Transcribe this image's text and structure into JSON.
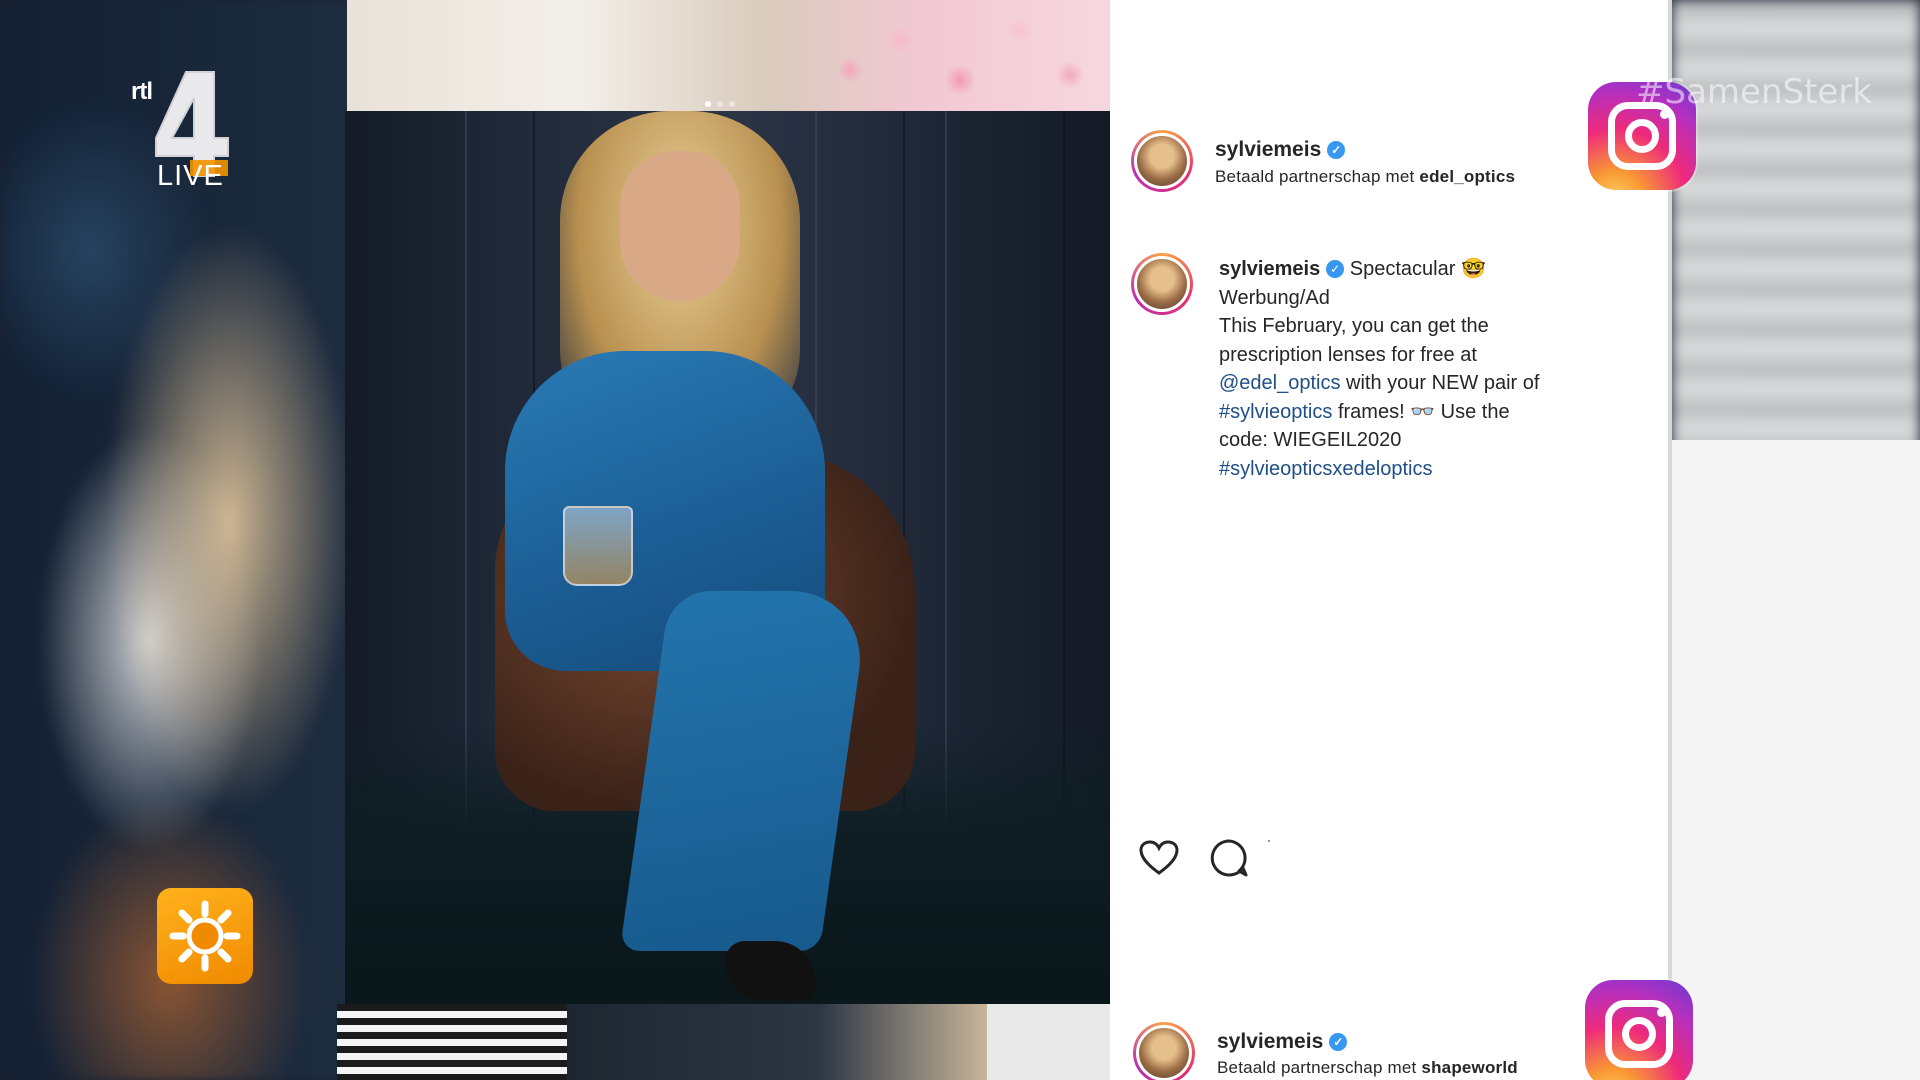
{
  "channel": {
    "name": "rtl",
    "number": "4",
    "live_label": "LIVE"
  },
  "overlay": {
    "hashtag": "#SamenSterk"
  },
  "post_header": {
    "username": "sylviemeis",
    "partnership_prefix": "Betaald partnerschap met",
    "partner": "edel_optics"
  },
  "caption": {
    "username": "sylviemeis",
    "first_word": "Spectacular 🤓",
    "line_ad": "Werbung/Ad",
    "line_1": "This February, you can get the",
    "line_2": "prescription lenses for free at",
    "mention": "@edel_optics",
    "line_3_rest": " with your NEW pair of",
    "hashtag_1": "#sylvieoptics",
    "line_4_rest": " frames! 👓 Use the",
    "line_5": "code: WIEGEIL2020",
    "hashtag_2": "#sylvieopticsxedeloptics"
  },
  "next_post_header": {
    "username": "sylviemeis",
    "partnership_prefix": "Betaald partnerschap met",
    "partner": "shapeworld"
  },
  "icons": {
    "like": "heart-icon",
    "comment": "comment-icon",
    "verified": "verified-badge-icon",
    "instagram": "instagram-logo-icon",
    "show_logo": "sun-logo-icon"
  },
  "colors": {
    "link": "#1f4f86",
    "verified": "#3897f0",
    "text": "#262626"
  }
}
